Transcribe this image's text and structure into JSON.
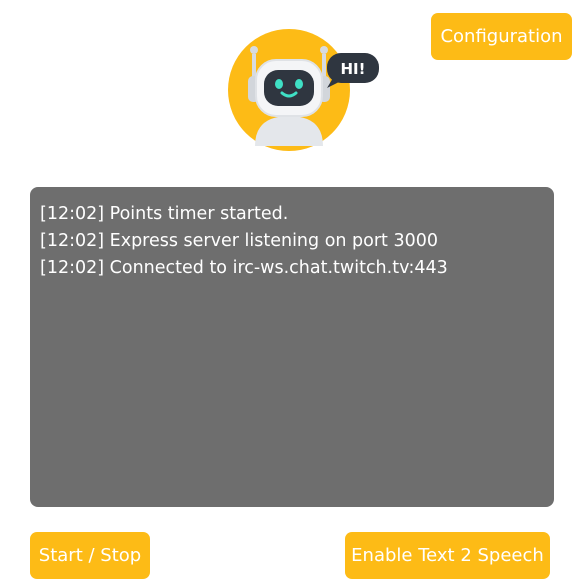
{
  "header": {
    "configuration_label": "Configuration",
    "logo": {
      "icon": "robot-hi-logo",
      "speech_bubble_text": "HI!",
      "accent_color": "#fdbb16",
      "bubble_color": "#2f3640"
    }
  },
  "log": {
    "lines": [
      "[12:02] Points timer started.",
      "[12:02] Express server listening on port 3000",
      "[12:02] Connected to irc-ws.chat.twitch.tv:443"
    ],
    "background_color": "#6e6e6e"
  },
  "controls": {
    "start_stop_label": "Start / Stop",
    "tts_label": "Enable Text 2 Speech"
  },
  "colors": {
    "button_bg": "#fdbb16",
    "button_text": "#ffffff"
  }
}
